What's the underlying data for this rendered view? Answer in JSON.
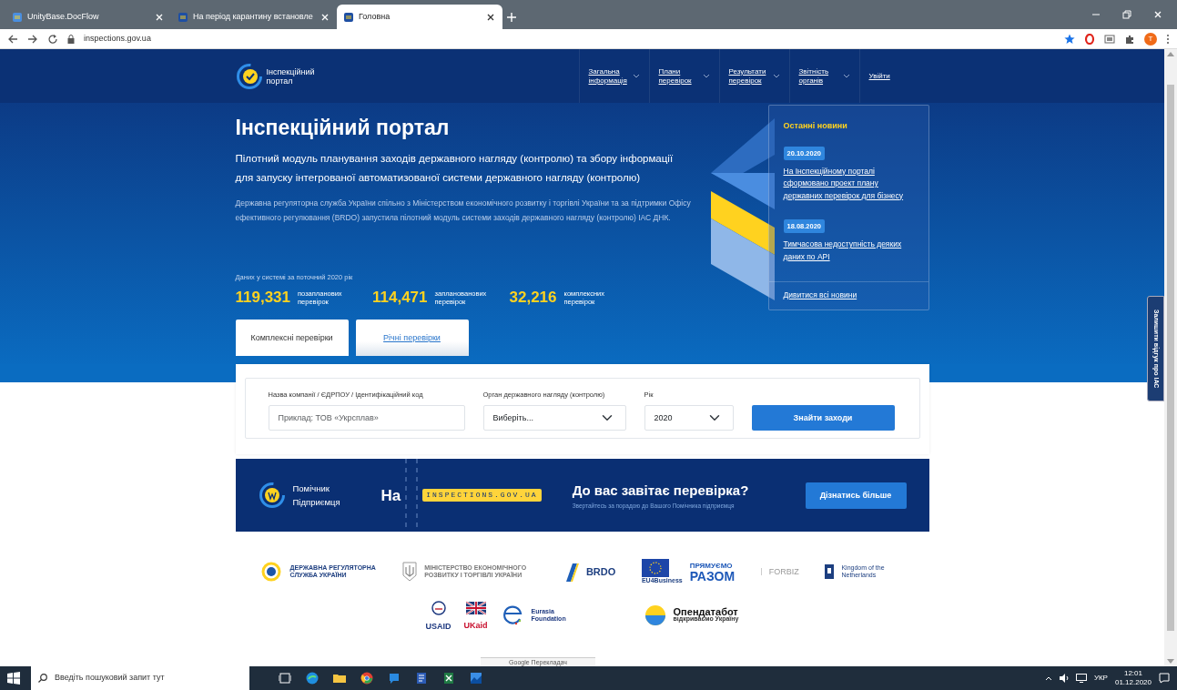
{
  "browser": {
    "tabs": [
      {
        "title": "UnityBase.DocFlow",
        "selected": false
      },
      {
        "title": "На період карантину встановле",
        "selected": false
      },
      {
        "title": "Головна",
        "selected": true
      }
    ],
    "url": "inspections.gov.ua",
    "avatar": "T"
  },
  "header": {
    "logo": "Інспекційний портал",
    "nav": [
      {
        "label": "Загальна інформація",
        "dropdown": true
      },
      {
        "label": "Плани перевірок",
        "dropdown": true
      },
      {
        "label": "Результати перевірок",
        "dropdown": true
      },
      {
        "label": "Звітність органів",
        "dropdown": true
      },
      {
        "label": "Увійти",
        "dropdown": false
      }
    ]
  },
  "hero": {
    "title": "Інспекційний портал",
    "subtitle": "Пілотний модуль планування заходів державного нагляду (контролю) та збору інформації для запуску інтегрованої автоматизованої системи державного нагляду (контролю)",
    "description": "Державна регуляторна служба України спільно з Міністерством економічного розвитку і торгівлі України та за підтримки Офісу ефективного регулювання (BRDO) запустила пілотний модуль системи заходів державного нагляду (контролю) ІАС ДНК.",
    "stats_caption": "Даних у системі за поточний 2020 рік",
    "stats": [
      {
        "value": "119,331",
        "label": "позапланових перевірок"
      },
      {
        "value": "114,471",
        "label": "запланованових перевірок"
      },
      {
        "value": "32,216",
        "label": "комплексних перевірок"
      }
    ]
  },
  "news": {
    "title": "Останні новини",
    "items": [
      {
        "date": "20.10.2020",
        "title": "На Інспекційному порталі сформовано проект плану державних перевірок для бізнесу"
      },
      {
        "date": "18.08.2020",
        "title": "Тимчасова недоступність деяких даних по API"
      }
    ],
    "all_link": "Дивитися всі новини"
  },
  "tabs": [
    {
      "label": "Комплексні перевірки",
      "selected": true
    },
    {
      "label": "Річні перевірки",
      "selected": false
    }
  ],
  "search": {
    "fields": [
      {
        "kind": "text",
        "label": "Назва компанії / ЄДРПОУ / Ідентифікаційний код",
        "placeholder": "Приклад: ТОВ «Укрсплав»"
      },
      {
        "kind": "select",
        "label": "Орган державного нагляду (контролю)",
        "value": "Виберіть..."
      },
      {
        "kind": "select",
        "label": "Рік",
        "value": "2020"
      }
    ],
    "button": "Знайти заходи"
  },
  "banner": {
    "logo": "Помічник Підприємця",
    "prefix": "На",
    "site": "INSPECTIONS.GOV.UA",
    "title": "До вас завітає перевірка?",
    "subtitle": "Звертайтесь за порадою до Вашого Помічника підприємця",
    "button": "Дізнатись більше"
  },
  "partners": [
    [
      {
        "kind": "drs",
        "texts": [
          "ДЕРЖАВНА РЕГУЛЯТОРНА СЛУЖБА УКРАЇНИ"
        ]
      },
      {
        "kind": "ministry",
        "texts": [
          "МІНІСТЕРСТВО ЕКОНОМІЧНОГО РОЗВИТКУ І ТОРГІВЛІ УКРАЇНИ"
        ]
      },
      {
        "kind": "brdo",
        "texts": [
          "BRDO"
        ]
      },
      {
        "kind": "eu",
        "texts": [
          "ПРЯМУЄМО",
          "РАЗОМ",
          "EU4Business"
        ]
      },
      {
        "kind": "forbiz",
        "texts": [
          "FORBIZ"
        ]
      },
      {
        "kind": "nl",
        "texts": [
          "Kingdom of the Netherlands"
        ]
      }
    ],
    [
      {
        "kind": "usaid",
        "texts": [
          "USAID"
        ]
      },
      {
        "kind": "ukaid",
        "texts": [
          "UKaid"
        ]
      },
      {
        "kind": "eurasia",
        "texts": [
          "Eurasia Foundation"
        ]
      },
      {
        "kind": "opendatabot",
        "texts": [
          "Опендатабот",
          "відкриваємо Україну"
        ]
      }
    ]
  ],
  "feedback": "Залишити відгук про ІАС",
  "translate_bar": "Google Перекладач",
  "taskbar": {
    "search_placeholder": "Введіть пошуковий запит тут",
    "language": "УКР",
    "time": "12:01",
    "date": "01.12.2020"
  }
}
